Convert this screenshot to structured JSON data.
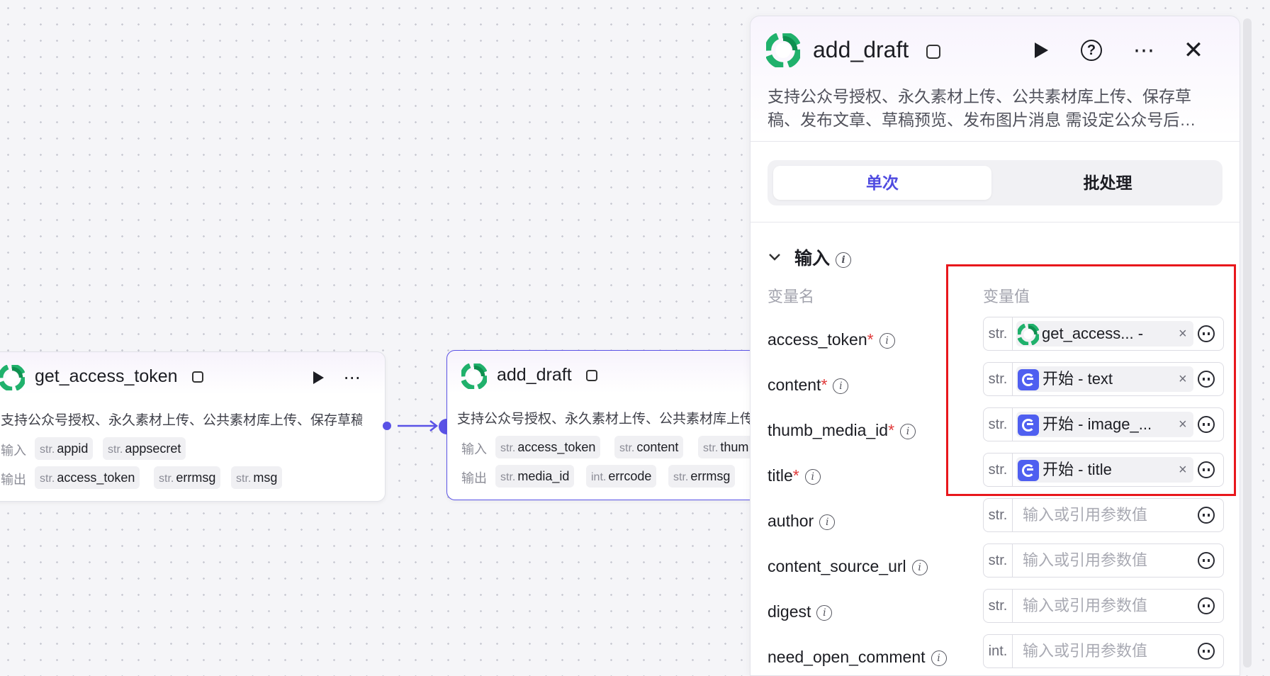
{
  "colors": {
    "accent": "#5a52e6",
    "required": "#e03a3a",
    "highlight": "#e8171c",
    "start_icon": "#4f5ff0"
  },
  "nodes": [
    {
      "title": "get_access_token",
      "description": "支持公众号授权、永久素材上传、公共素材库上传、保存草稿…",
      "input_label": "输入",
      "output_label": "输出",
      "inputs": [
        {
          "type": "str.",
          "name": "appid"
        },
        {
          "type": "str.",
          "name": "appsecret"
        }
      ],
      "outputs": [
        {
          "type": "str.",
          "name": "access_token"
        },
        {
          "type": "str.",
          "name": "errmsg"
        },
        {
          "type": "str.",
          "name": "msg"
        }
      ]
    },
    {
      "title": "add_draft",
      "description": "支持公众号授权、永久素材上传、公共素材库上传",
      "input_label": "输入",
      "output_label": "输出",
      "inputs": [
        {
          "type": "str.",
          "name": "access_token"
        },
        {
          "type": "str.",
          "name": "content"
        },
        {
          "type": "str.",
          "name": "thum"
        }
      ],
      "outputs": [
        {
          "type": "str.",
          "name": "media_id"
        },
        {
          "type": "int.",
          "name": "errcode"
        },
        {
          "type": "str.",
          "name": "errmsg"
        }
      ]
    }
  ],
  "panel": {
    "title": "add_draft",
    "description_line1": "支持公众号授权、永久素材上传、公共素材库上传、保存草",
    "description_line2": "稿、发布文章、草稿预览、发布图片消息 需设定公众号后…",
    "tabs": [
      {
        "label": "单次",
        "active": true
      },
      {
        "label": "批处理",
        "active": false
      }
    ],
    "section_title": "输入",
    "col_name": "变量名",
    "col_value": "变量值",
    "params": [
      {
        "name": "access_token",
        "required": true,
        "type": "str.",
        "ref_source": "plugin",
        "ref_label": "get_access...",
        "ref_suffix": "-"
      },
      {
        "name": "content",
        "required": true,
        "type": "str.",
        "ref_source": "start",
        "ref_label": "开始",
        "ref_suffix": "- text"
      },
      {
        "name": "thumb_media_id",
        "required": true,
        "type": "str.",
        "ref_source": "start",
        "ref_label": "开始",
        "ref_suffix": "- image_..."
      },
      {
        "name": "title",
        "required": true,
        "type": "str.",
        "ref_source": "start",
        "ref_label": "开始",
        "ref_suffix": "- title"
      },
      {
        "name": "author",
        "required": false,
        "type": "str.",
        "placeholder": "输入或引用参数值"
      },
      {
        "name": "content_source_url",
        "required": false,
        "type": "str.",
        "placeholder": "输入或引用参数值"
      },
      {
        "name": "digest",
        "required": false,
        "type": "str.",
        "placeholder": "输入或引用参数值"
      },
      {
        "name": "need_open_comment",
        "required": false,
        "type": "int.",
        "placeholder": "输入或引用参数值"
      }
    ]
  }
}
